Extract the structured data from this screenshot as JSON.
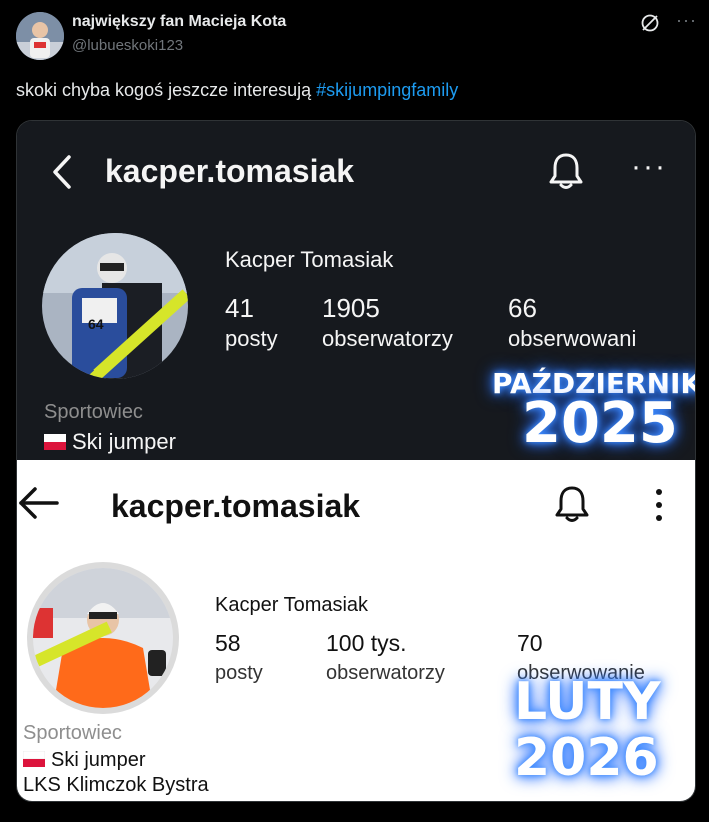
{
  "tweet": {
    "username": "największy fan Macieja Kota",
    "handle": "@lubueskoki123",
    "text": "skoki chyba kogoś jeszcze interesują",
    "hashtag": "#skijumpingfamily",
    "icons": [
      "avatar",
      "grok-icon",
      "more-icon"
    ]
  },
  "top_profile": {
    "handle": "kacper.tomasiak",
    "name": "Kacper Tomasiak",
    "stats": [
      {
        "value": "41",
        "label": "posty"
      },
      {
        "value": "1905",
        "label": "obserwatorzy"
      },
      {
        "value": "66",
        "label": "obserwowani"
      }
    ],
    "category": "Sportowiec",
    "bio": "Ski jumper",
    "overlay_month": "PAŹDZIERNIK",
    "overlay_year": "2025",
    "bg_color": "#16191e"
  },
  "bottom_profile": {
    "handle": "kacper.tomasiak",
    "name": "Kacper Tomasiak",
    "stats": [
      {
        "value": "58",
        "label": "posty"
      },
      {
        "value": "100 tys.",
        "label": "obserwatorzy"
      },
      {
        "value": "70",
        "label": "obserwowanie"
      }
    ],
    "category": "Sportowiec",
    "bio": "Ski jumper",
    "club": "LKS Klimczok Bystra",
    "overlay_month": "LUTY",
    "overlay_year": "2026",
    "bg_color": "#ffffff"
  },
  "colors": {
    "accent": "#1d9bf0",
    "glow": "#3d8bff"
  }
}
